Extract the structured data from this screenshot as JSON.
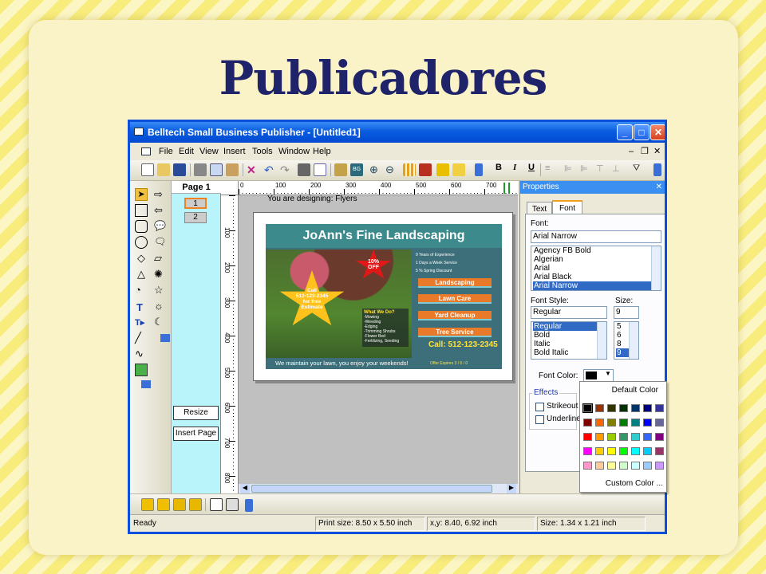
{
  "slide": {
    "title": "Publicadores"
  },
  "window": {
    "title": "Belltech Small Business Publisher - [Untitled1]"
  },
  "menu": [
    "File",
    "Edit",
    "View",
    "Insert",
    "Tools",
    "Window",
    "Help"
  ],
  "format_toolbar": {
    "bold": "B",
    "italic": "I",
    "underline": "U"
  },
  "pages": {
    "header": "Page 1",
    "thumbs": [
      "1",
      "2"
    ],
    "resize_label": "Resize",
    "insert_label": "Insert Page"
  },
  "canvas": {
    "designing_label": "You are designing: Flyers",
    "ruler_h": [
      "0",
      "100",
      "200",
      "300",
      "400",
      "500",
      "600",
      "700"
    ],
    "ruler_v": [
      "100",
      "200",
      "300",
      "400",
      "500",
      "600",
      "700",
      "800"
    ]
  },
  "flyer": {
    "title": "JoAnn's Fine Landscaping",
    "call_text": [
      "Call",
      "512-123-2345",
      "for free",
      "Estimate"
    ],
    "discount": [
      "10%",
      "OFF"
    ],
    "bullets": [
      "9 Years of Experience",
      "1 Days a Week Service",
      "5 % Spring Discount"
    ],
    "services": [
      "Landscaping",
      "Lawn Care",
      "Yard Cleanup",
      "Tree Service"
    ],
    "what_heading": "What We Do?",
    "what_items": [
      "-Mowing",
      "-Weeding",
      "-Edging",
      "-Trimming Shrubs",
      "-Flower Bed",
      "-Fertilizing, Seeding"
    ],
    "phone": "Call: 512-123-2345",
    "footer_left": "We maintain your lawn, you enjoy your weekends!",
    "footer_right": "Offer Expires 3 / 6 / 0"
  },
  "properties": {
    "title": "Properties",
    "tabs": [
      "Text",
      "Font"
    ],
    "font_label": "Font:",
    "font_value": "Arial Narrow",
    "font_list": [
      "Agency FB Bold",
      "Algerian",
      "Arial",
      "Arial Black",
      "Arial Narrow"
    ],
    "style_label": "Font Style:",
    "style_value": "Regular",
    "style_list": [
      "Regular",
      "Bold",
      "Italic",
      "Bold Italic"
    ],
    "size_label": "Size:",
    "size_value": "9",
    "size_list": [
      "5",
      "6",
      "8",
      "9"
    ],
    "color_label": "Font Color:",
    "effects_label": "Effects",
    "strikeout_label": "Strikeout",
    "underline_label": "Underline"
  },
  "palette": {
    "default_label": "Default Color",
    "custom_label": "Custom Color ...",
    "colors": [
      [
        "#000000",
        "#993300",
        "#333300",
        "#003300",
        "#003366",
        "#000080",
        "#333399"
      ],
      [
        "#800000",
        "#ff6600",
        "#808000",
        "#008000",
        "#008080",
        "#0000ff",
        "#666699"
      ],
      [
        "#ff0000",
        "#ff9900",
        "#99cc00",
        "#339966",
        "#33cccc",
        "#3366ff",
        "#800080"
      ],
      [
        "#ff00ff",
        "#ffcc00",
        "#ffff00",
        "#00ff00",
        "#00ffff",
        "#00ccff",
        "#993366"
      ],
      [
        "#ff99cc",
        "#ffcc99",
        "#ffff99",
        "#ccffcc",
        "#ccffff",
        "#99ccff",
        "#cc99ff"
      ]
    ]
  },
  "status": {
    "ready": "Ready",
    "print_size": "Print size: 8.50 x 5.50 inch",
    "xy": "x,y: 8.40, 6.92 inch",
    "size": "Size: 1.34 x 1.21 inch"
  }
}
